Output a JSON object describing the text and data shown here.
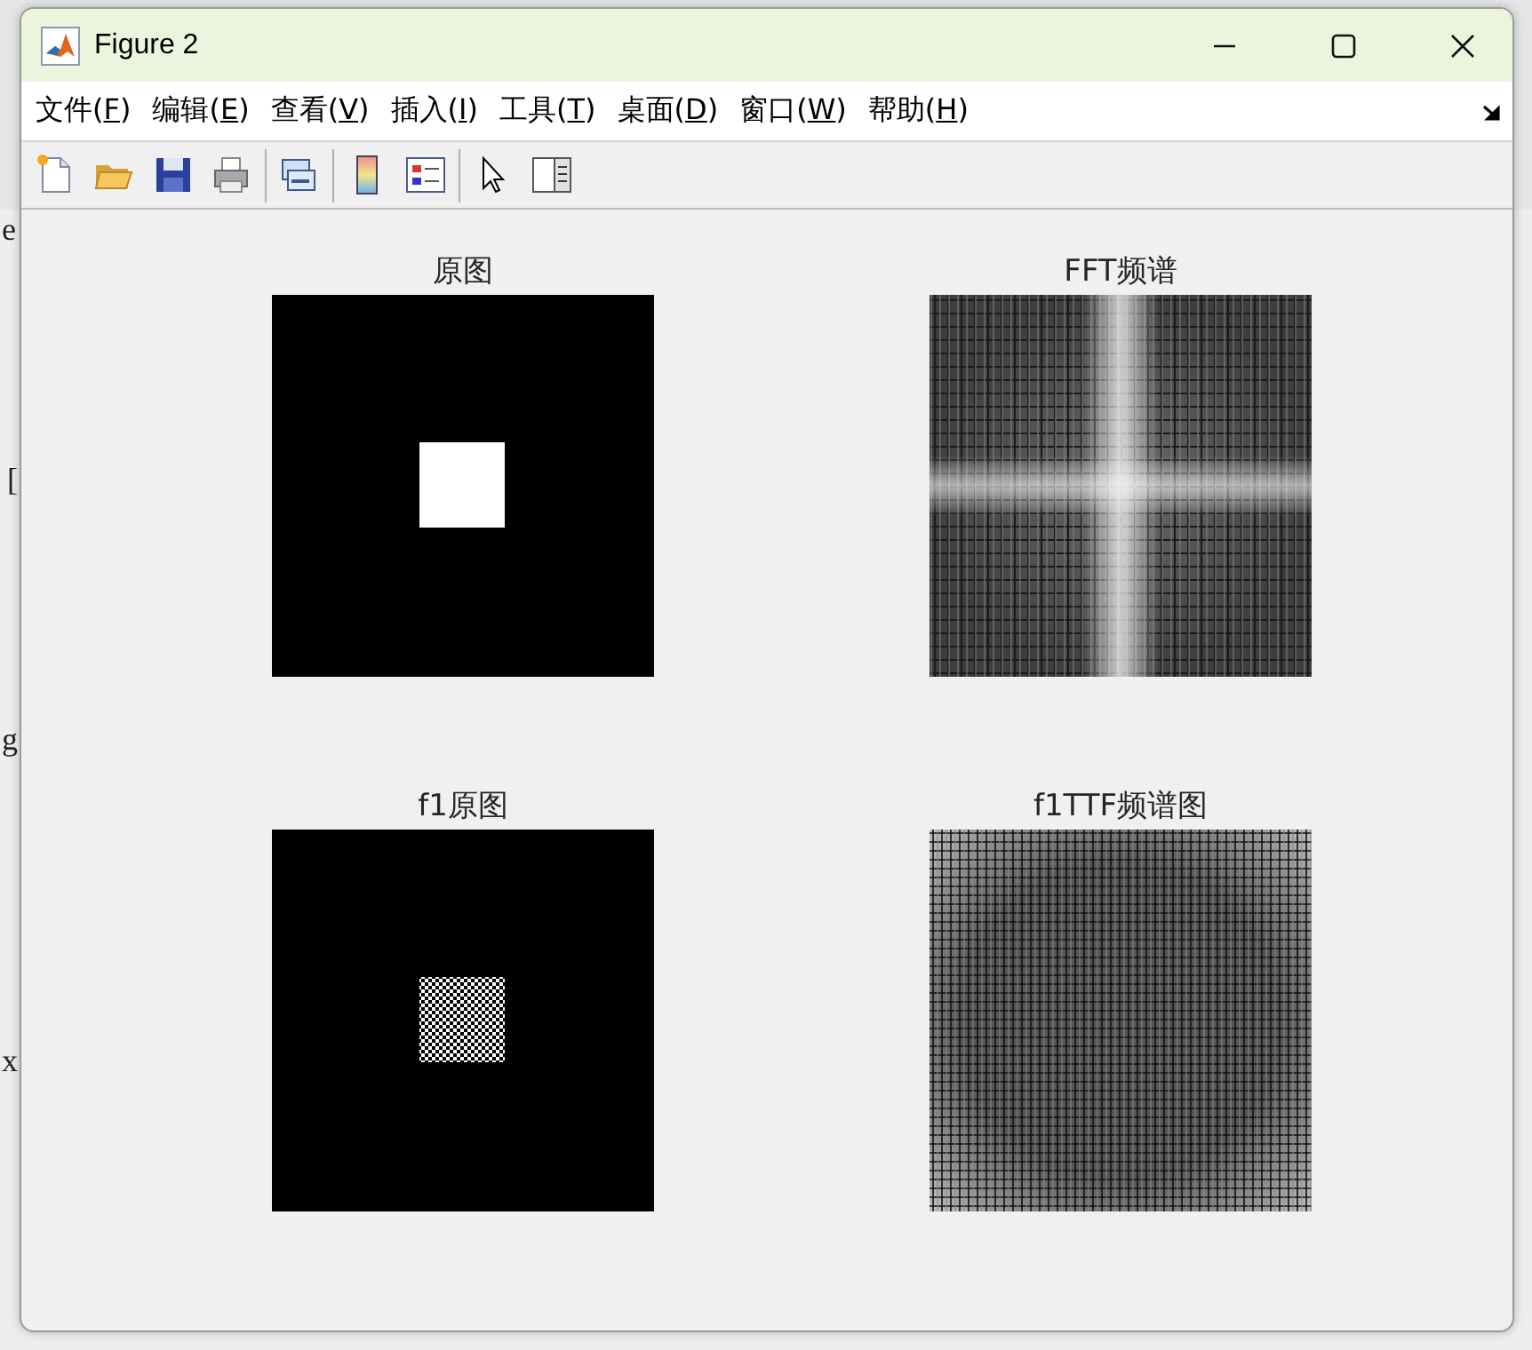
{
  "background_fragments": [
    "e",
    "[",
    "g",
    "x"
  ],
  "window": {
    "title": "Figure 2"
  },
  "menu": [
    {
      "before": "文件(",
      "key": "F",
      "after": ")"
    },
    {
      "before": "编辑(",
      "key": "E",
      "after": ")"
    },
    {
      "before": "查看(",
      "key": "V",
      "after": ")"
    },
    {
      "before": "插入(",
      "key": "I",
      "after": ")"
    },
    {
      "before": "工具(",
      "key": "T",
      "after": ")"
    },
    {
      "before": "桌面(",
      "key": "D",
      "after": ")"
    },
    {
      "before": "窗口(",
      "key": "W",
      "after": ")"
    },
    {
      "before": "帮助(",
      "key": "H",
      "after": ")"
    }
  ],
  "toolbar": [
    {
      "kind": "new"
    },
    {
      "kind": "open"
    },
    {
      "kind": "save"
    },
    {
      "kind": "print"
    },
    {
      "kind": "separator"
    },
    {
      "kind": "link"
    },
    {
      "kind": "separator"
    },
    {
      "kind": "colorbar"
    },
    {
      "kind": "legend"
    },
    {
      "kind": "separator"
    },
    {
      "kind": "pointer"
    },
    {
      "kind": "panel"
    }
  ],
  "plots": [
    {
      "title": "原图",
      "kind": "square"
    },
    {
      "title": "FFT频谱",
      "kind": "spectrum"
    },
    {
      "title": "f1原图",
      "kind": "checker"
    },
    {
      "title": "f1TTF频谱图",
      "kind": "flat-spectrum"
    }
  ]
}
